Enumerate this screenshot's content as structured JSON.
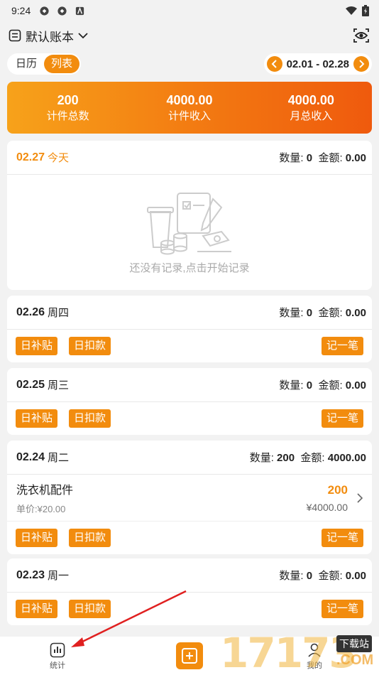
{
  "status_bar": {
    "time": "9:24"
  },
  "header": {
    "book_title": "默认账本"
  },
  "toggle": {
    "calendar": "日历",
    "list": "列表"
  },
  "range": {
    "text": "02.01 - 02.28"
  },
  "summary": {
    "count_value": "200",
    "count_label": "计件总数",
    "piece_income_value": "4000.00",
    "piece_income_label": "计件收入",
    "monthly_income_value": "4000.00",
    "monthly_income_label": "月总收入"
  },
  "days": [
    {
      "date": "02.27",
      "weekday": "今天",
      "qty_label": "数量: ",
      "qty": "0",
      "amt_label": "金额: ",
      "amt": "0.00",
      "empty_msg": "还没有记录,点击开始记录"
    },
    {
      "date": "02.26",
      "weekday": "周四",
      "qty_label": "数量: ",
      "qty": "0",
      "amt_label": "金额: ",
      "amt": "0.00"
    },
    {
      "date": "02.25",
      "weekday": "周三",
      "qty_label": "数量: ",
      "qty": "0",
      "amt_label": "金额: ",
      "amt": "0.00"
    },
    {
      "date": "02.24",
      "weekday": "周二",
      "qty_label": "数量: ",
      "qty": "200",
      "amt_label": "金额: ",
      "amt": "4000.00",
      "item": {
        "name": "洗衣机配件",
        "unit_price": "单价:¥20.00",
        "quantity": "200",
        "amount": "¥4000.00"
      }
    },
    {
      "date": "02.23",
      "weekday": "周一",
      "qty_label": "数量: ",
      "qty": "0",
      "amt_label": "金额: ",
      "amt": "0.00"
    }
  ],
  "actions": {
    "subsidy": "日补贴",
    "deduction": "日扣款",
    "record": "记一笔"
  },
  "bottom_nav": {
    "stats": "统计",
    "mine": "我的"
  },
  "watermark": {
    "number": "17173",
    "tag": "下载站",
    "domain": ".COM"
  },
  "colors": {
    "accent": "#f28c0e",
    "gradient_start": "#f7a21a",
    "gradient_end": "#ef5a0d",
    "arrow": "#e02020"
  },
  "icons": [
    "wifi-icon",
    "battery-icon",
    "book-icon",
    "chevron-down-icon",
    "eye-icon",
    "chevron-left-icon",
    "chevron-right-icon",
    "stats-icon",
    "add-icon"
  ]
}
